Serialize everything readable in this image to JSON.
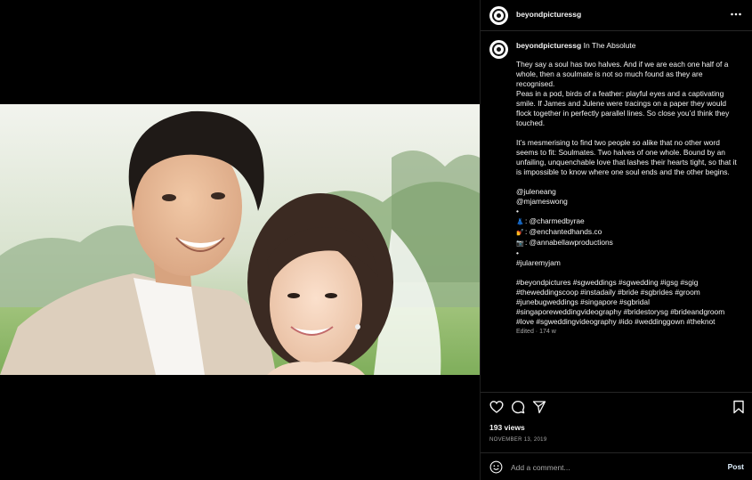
{
  "post": {
    "username": "beyondpicturessg",
    "location": "In The Absolute"
  },
  "caption": {
    "paragraphs": [
      "They say a soul has two halves. And if we are each one half of a whole, then a soulmate is not so much found as they are recognised.",
      "Peas in a pod, birds of a feather: playful eyes and a captivating smile. If James and Julene were tracings on a paper they would flock together in perfectly parallel lines. So close you’d think they touched.",
      "It’s mesmerising to find two people so alike that no other word seems to fit: Soulmates. Two halves of one whole. Bound by an unfailing, unquenchable love that lashes their hearts tight, so that it is impossible to know where one soul ends and the other begins."
    ],
    "mention_1": "@juleneang",
    "mention_2": "@mjameswong",
    "bullet": "•",
    "credit_1_emoji": "👗",
    "credit_1": ": @charmedbyrae",
    "credit_2_emoji": "💅",
    "credit_2": ": @enchantedhands.co",
    "credit_3_emoji": "📷",
    "credit_3": ": @annabellawproductions",
    "main_hashtag": "#jularemyjam",
    "hashtags": "#beyondpictures #sgweddings #sgwedding #igsg #sgig #theweddingscoop #instadaily #bride #sgbrides #groom #junebugweddings #singapore #sgbridal #singaporeweddingvideography #bridestorysg #brideandgroom #love #sgweddingvideography #ido #weddinggown #theknot",
    "edited": "Edited · 174 w"
  },
  "stats": {
    "views": "193 views",
    "date": "NOVEMBER 13, 2019"
  },
  "comment": {
    "placeholder": "Add a comment...",
    "post_label": "Post"
  },
  "icons": {
    "more": "more-options-icon",
    "like": "heart-icon",
    "comment": "comment-icon",
    "share": "share-icon",
    "save": "bookmark-icon",
    "mute": "muted-speaker-icon",
    "emoji": "smiley-icon"
  },
  "colors": {
    "background": "#000000",
    "text": "#f5f5f5",
    "muted_text": "#a8a8a8",
    "divider": "#262626"
  }
}
